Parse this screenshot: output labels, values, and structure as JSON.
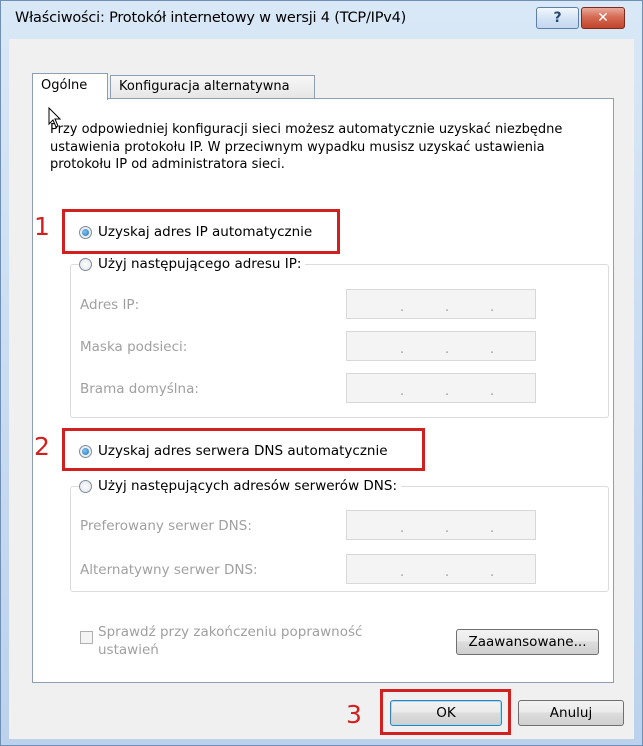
{
  "window": {
    "title": "Właściwości: Protokół internetowy w wersji 4 (TCP/IPv4)",
    "help_label": "?",
    "close_label": "✕"
  },
  "tabs": [
    "Ogólne",
    "Konfiguracja alternatywna"
  ],
  "intro_text": "Przy odpowiedniej konfiguracji sieci możesz automatycznie uzyskać niezbędne ustawienia protokołu IP. W przeciwnym wypadku musisz uzyskać ustawienia protokołu IP od administratora sieci.",
  "ip_section": {
    "auto_label": "Uzyskaj adres IP automatycznie",
    "auto_selected": true,
    "manual_label": "Użyj następującego adresu IP:",
    "fields": [
      {
        "label": "Adres IP:"
      },
      {
        "label": "Maska podsieci:"
      },
      {
        "label": "Brama domyślna:"
      }
    ]
  },
  "dns_section": {
    "auto_label": "Uzyskaj adres serwera DNS automatycznie",
    "auto_selected": true,
    "manual_label": "Użyj następujących adresów serwerów DNS:",
    "fields": [
      {
        "label": "Preferowany serwer DNS:"
      },
      {
        "label": "Alternatywny serwer DNS:"
      }
    ]
  },
  "validate_label_line1": "Sprawdź przy zakończeniu poprawność",
  "validate_label_line2": "ustawień",
  "buttons": {
    "advanced": "Zaawansowane...",
    "ok": "OK",
    "cancel": "Anuluj"
  },
  "callouts": [
    "1",
    "2",
    "3"
  ],
  "colors": {
    "callout": "#d21f1f"
  }
}
